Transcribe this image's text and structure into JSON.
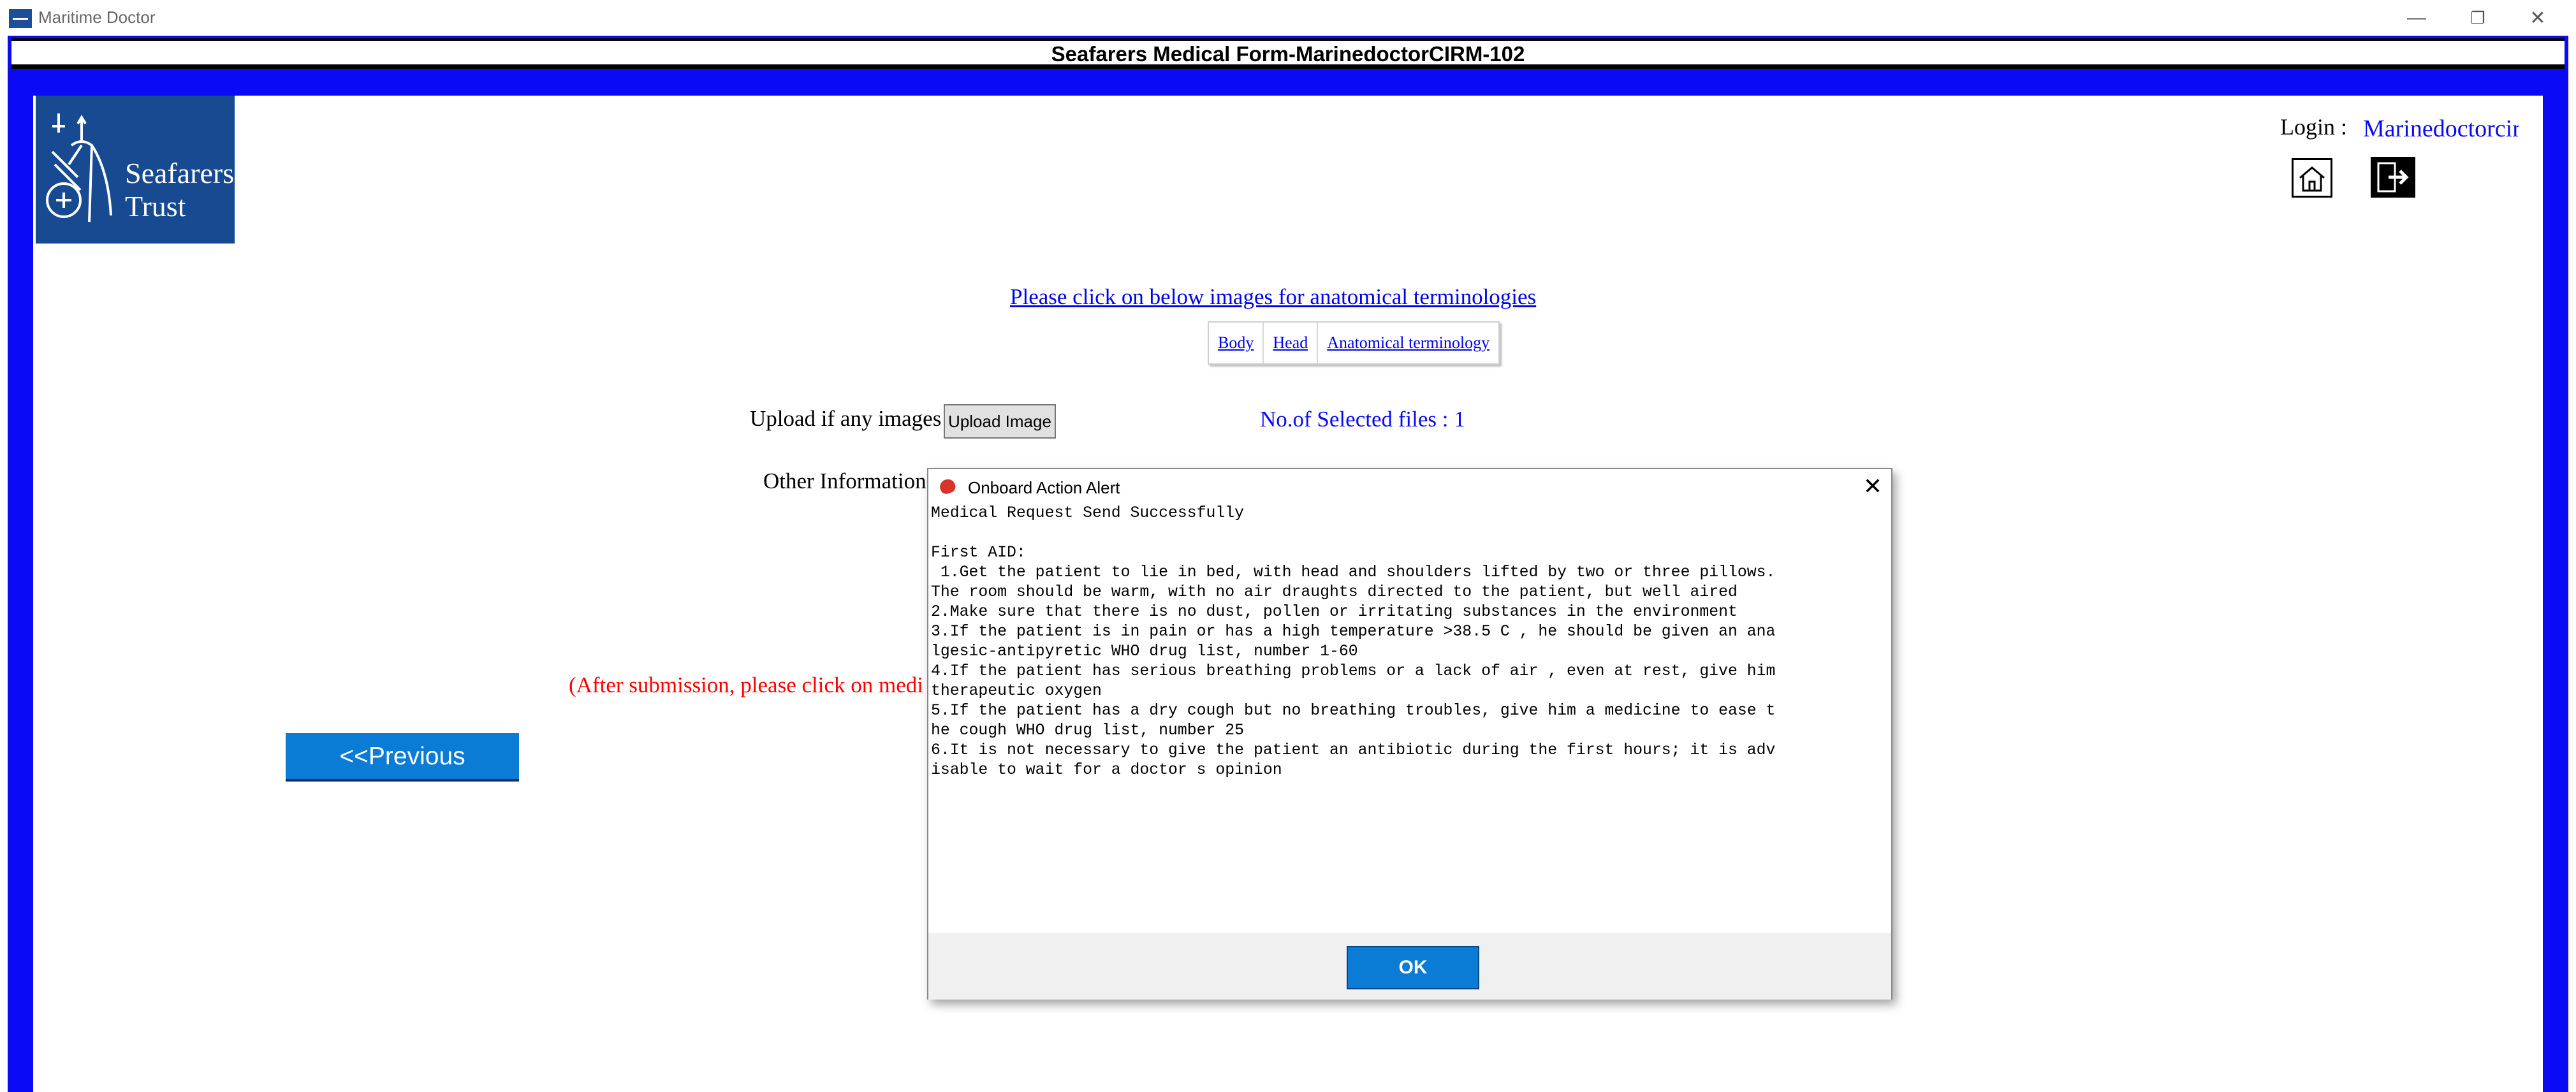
{
  "window": {
    "app_title": "Maritime Doctor",
    "minimize": "—",
    "maximize": "❐",
    "close": "✕"
  },
  "form": {
    "title": "Seafarers Medical Form-MarinedoctorCIRM-102"
  },
  "logo": {
    "line1": "Seafarers'",
    "line2": "Trust"
  },
  "login": {
    "label": "Login :",
    "user": "Marinedoctorcirm"
  },
  "anatomy": {
    "link": "Please click on below images for anatomical terminologies",
    "tabs": [
      "Body",
      "Head",
      "Anatomical terminology"
    ]
  },
  "upload": {
    "label": "Upload if any images",
    "button": "Upload Image",
    "selected_files": "No.of Selected files : 1"
  },
  "other_info_label": "Other Information",
  "note": "(After submission, please click on medi",
  "previous_button": "<<Previous",
  "dialog": {
    "title": "Onboard Action Alert",
    "close": "✕",
    "message": "Medical Request Send Successfully\n\nFirst AID:\n 1.Get the patient to lie in bed, with head and shoulders lifted by two or three pillows.\nThe room should be warm, with no air draughts directed to the patient, but well aired\n2.Make sure that there is no dust, pollen or irritating substances in the environment\n3.If the patient is in pain or has a high temperature >38.5 C , he should be given an ana\nlgesic-antipyretic WHO drug list, number 1-60\n4.If the patient has serious breathing problems or a lack of air , even at rest, give him\ntherapeutic oxygen\n5.If the patient has a dry cough but no breathing troubles, give him a medicine to ease t\nhe cough WHO drug list, number 25\n6.It is not necessary to give the patient an antibiotic during the first hours; it is adv\nisable to wait for a doctor s opinion",
    "ok": "OK"
  }
}
